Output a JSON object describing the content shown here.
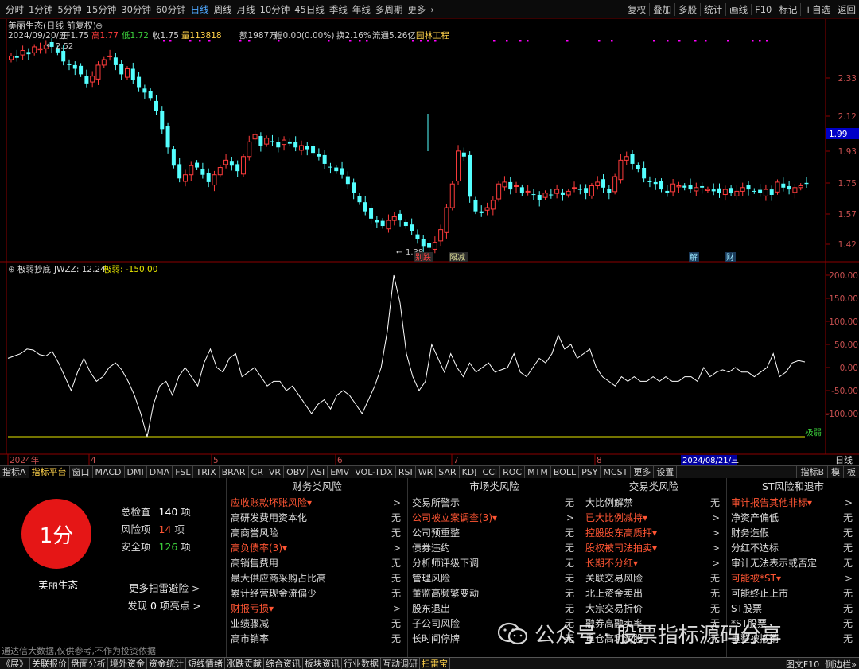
{
  "toolbar": {
    "timeframes": [
      "分时",
      "1分钟",
      "5分钟",
      "15分钟",
      "30分钟",
      "60分钟",
      "日线",
      "周线",
      "月线",
      "10分钟",
      "45日线",
      "季线",
      "年线",
      "多周期",
      "更多"
    ],
    "active_timeframe": "日线",
    "right_buttons": [
      "复权",
      "叠加",
      "多股",
      "统计",
      "画线",
      "F10",
      "标记",
      "+自选",
      "返回"
    ]
  },
  "header": {
    "stock": "美丽生态(日线 前复权)",
    "date": "2024/09/20/五",
    "open": "开1.75",
    "high": "高1.77",
    "low": "低1.72",
    "close": "收1.75",
    "volume": "量113818",
    "amount": "额1987万",
    "change": "幅0.00(0.00%)",
    "turnover": "换2.16%",
    "float": "流通5.26亿",
    "sector": "园林工程"
  },
  "price_axis": [
    "2.33",
    "2.12",
    "1.93",
    "1.75",
    "1.57",
    "1.42"
  ],
  "current_price_tag": "1.99",
  "annotations": {
    "high": "2.52",
    "low": "1.38"
  },
  "event_tags": [
    "别跌",
    "限减",
    "解",
    "财"
  ],
  "indicator": {
    "title": "极弱抄底",
    "jwzz": "JWZZ: 12.24",
    "jr": "极弱: -150.00",
    "axis": [
      "200.00",
      "150.00",
      "100.00",
      "50.00",
      "0.00",
      "-50.00",
      "-100.00"
    ],
    "line_label": "极弱"
  },
  "time_axis": {
    "labels": [
      "2024年",
      "4",
      "5",
      "6",
      "7",
      "8"
    ],
    "cursor_date": "2024/08/21/三",
    "period": "日线"
  },
  "indicator_tabs": [
    "指标A",
    "指标平台",
    "窗口",
    "MACD",
    "DMI",
    "DMA",
    "FSL",
    "TRIX",
    "BRAR",
    "CR",
    "VR",
    "OBV",
    "ASI",
    "EMV",
    "VOL-TDX",
    "RSI",
    "WR",
    "SAR",
    "KDJ",
    "CCI",
    "ROC",
    "MTM",
    "BOLL",
    "PSY",
    "MCST",
    "更多",
    "设置"
  ],
  "active_indicator_tab": "指标平台",
  "indicator_tabs_right": [
    "指标B",
    "模",
    "板"
  ],
  "scan": {
    "score": "1分",
    "total_label": "总检查",
    "total": "140",
    "total_unit": "项",
    "risk_label": "风险项",
    "risk": "14",
    "risk_unit": "项",
    "safe_label": "安全项",
    "safe": "126",
    "safe_unit": "项",
    "stock_name": "美丽生态",
    "more_scan": "更多扫雷避险 >",
    "find_prefix": "发现",
    "find_count": "0",
    "find_suffix": "项亮点 >",
    "disclaimer": "通达信大数据,仅供参考,不作为投资依据",
    "accent": "#e51616",
    "risk_color": "#ff5533"
  },
  "scan_columns": [
    {
      "title": "财务类风险",
      "items": [
        {
          "label": "应收账款坏账风险",
          "value": ">",
          "risk": true
        },
        {
          "label": "高研发费用资本化",
          "value": "无",
          "risk": false
        },
        {
          "label": "高商誉风险",
          "value": "无",
          "risk": false
        },
        {
          "label": "高负债率(3)",
          "value": ">",
          "risk": true
        },
        {
          "label": "高销售费用",
          "value": "无",
          "risk": false
        },
        {
          "label": "最大供应商采购占比高",
          "value": "无",
          "risk": false
        },
        {
          "label": "累计经营现金流偏少",
          "value": "无",
          "risk": false
        },
        {
          "label": "财报亏损",
          "value": ">",
          "risk": true
        },
        {
          "label": "业绩骤减",
          "value": "无",
          "risk": false
        },
        {
          "label": "高市销率",
          "value": "无",
          "risk": false
        }
      ]
    },
    {
      "title": "市场类风险",
      "items": [
        {
          "label": "交易所警示",
          "value": "无",
          "risk": false
        },
        {
          "label": "公司被立案调查(3)",
          "value": ">",
          "risk": true
        },
        {
          "label": "公司预重整",
          "value": "无",
          "risk": false
        },
        {
          "label": "债券违约",
          "value": "无",
          "risk": false
        },
        {
          "label": "分析师评级下调",
          "value": "无",
          "risk": false
        },
        {
          "label": "管理风险",
          "value": "无",
          "risk": false
        },
        {
          "label": "董监高频繁变动",
          "value": "无",
          "risk": false
        },
        {
          "label": "股东退出",
          "value": "无",
          "risk": false
        },
        {
          "label": "子公司风险",
          "value": "无",
          "risk": false
        },
        {
          "label": "长时间停牌",
          "value": "无",
          "risk": false
        }
      ]
    },
    {
      "title": "交易类风险",
      "items": [
        {
          "label": "大比例解禁",
          "value": "无",
          "risk": false
        },
        {
          "label": "已大比例减持",
          "value": ">",
          "risk": true
        },
        {
          "label": "控股股东高质押",
          "value": ">",
          "risk": true
        },
        {
          "label": "股权被司法拍卖",
          "value": ">",
          "risk": true
        },
        {
          "label": "长期不分红",
          "value": ">",
          "risk": true
        },
        {
          "label": "关联交易风险",
          "value": "无",
          "risk": false
        },
        {
          "label": "北上资金卖出",
          "value": "无",
          "risk": false
        },
        {
          "label": "大宗交易折价",
          "value": "无",
          "risk": false
        },
        {
          "label": "融券高融卖率",
          "value": "无",
          "risk": false
        },
        {
          "label": "重仓高利润股",
          "value": "无",
          "risk": false
        }
      ]
    },
    {
      "title": "ST风险和退市",
      "items": [
        {
          "label": "审计报告其他非标",
          "value": ">",
          "risk": true
        },
        {
          "label": "净资产偏低",
          "value": "无",
          "risk": false
        },
        {
          "label": "财务造假",
          "value": "无",
          "risk": false
        },
        {
          "label": "分红不达标",
          "value": "无",
          "risk": false
        },
        {
          "label": "审计无法表示或否定",
          "value": "无",
          "risk": false
        },
        {
          "label": "可能被*ST",
          "value": ">",
          "risk": true
        },
        {
          "label": "可能终止上市",
          "value": "无",
          "risk": false
        },
        {
          "label": "ST股票",
          "value": "无",
          "risk": false
        },
        {
          "label": "*ST股票",
          "value": "无",
          "risk": false
        },
        {
          "label": "重整被撤销",
          "value": "无",
          "risk": false
        }
      ]
    }
  ],
  "watermark": "公众号 · 股票指标源码分享",
  "status_bar": {
    "items": [
      "《展》",
      "关联报价",
      "盘面分析",
      "境外资金",
      "资金统计",
      "短线情绪",
      "涨跌贡献",
      "综合资讯",
      "板块资讯",
      "行业数据",
      "互动调研",
      "扫雷宝"
    ],
    "active": "扫雷宝",
    "right": [
      "图文F10",
      "侧边栏»"
    ]
  },
  "colors": {
    "up": "#ff3c3c",
    "down": "#54ffff",
    "indicator_line": "#ffffff",
    "jr_line": "#e8e800",
    "axis": "#8b0000",
    "magenta": "#ff00ff"
  }
}
